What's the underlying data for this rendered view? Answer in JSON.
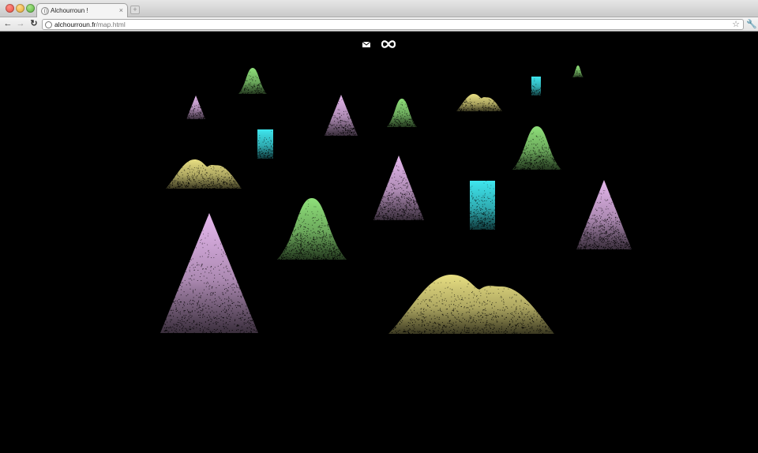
{
  "browser": {
    "tab": {
      "title": "Alchourroun !",
      "close": "×"
    },
    "new_tab": "+",
    "address": {
      "domain": "alchourroun.fr",
      "path": "/map.html"
    },
    "icons": {
      "back": "back-arrow-icon",
      "forward": "forward-arrow-icon",
      "reload": "reload-icon",
      "star": "star-icon",
      "wrench": "wrench-icon"
    }
  },
  "page": {
    "background": "#000000",
    "icons": [
      "mail-icon",
      "infinity-icon"
    ],
    "palette": {
      "pink": "#e6b8ee",
      "green": "#8fe07a",
      "yellow": "#e8df82",
      "cyan": "#3fe6ee"
    },
    "shapes": [
      {
        "kind": "peak",
        "color": "pink",
        "label": "small-pink-peak"
      },
      {
        "kind": "hill",
        "color": "green",
        "label": "small-green-hill"
      },
      {
        "kind": "peak",
        "color": "pink",
        "label": "pink-peak"
      },
      {
        "kind": "hill",
        "color": "green",
        "label": "green-hill"
      },
      {
        "kind": "twin-hill",
        "color": "yellow",
        "label": "small-yellow-twin-hill"
      },
      {
        "kind": "bar",
        "color": "cyan",
        "label": "tiny-cyan-bar"
      },
      {
        "kind": "hill",
        "color": "green",
        "label": "tiny-green-hill"
      },
      {
        "kind": "bar",
        "color": "cyan",
        "label": "cyan-bar"
      },
      {
        "kind": "twin-hill",
        "color": "yellow",
        "label": "yellow-twin-hill"
      },
      {
        "kind": "peak",
        "color": "pink",
        "label": "center-pink-peak"
      },
      {
        "kind": "hill",
        "color": "green",
        "label": "right-green-hill"
      },
      {
        "kind": "bar",
        "color": "cyan",
        "label": "large-cyan-bar"
      },
      {
        "kind": "hill",
        "color": "green",
        "label": "large-green-hill"
      },
      {
        "kind": "peak",
        "color": "pink",
        "label": "right-pink-peak"
      },
      {
        "kind": "peak",
        "color": "pink",
        "label": "large-pink-peak"
      },
      {
        "kind": "twin-hill",
        "color": "yellow",
        "label": "large-yellow-twin-hill"
      }
    ]
  }
}
